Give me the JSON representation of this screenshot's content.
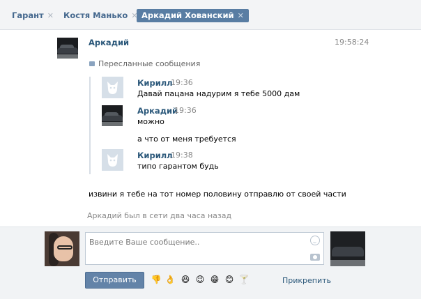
{
  "tabs": [
    {
      "label": "Гарант",
      "close": "✕",
      "active": false
    },
    {
      "label": "Костя Манько",
      "close": "✕",
      "active": false
    },
    {
      "label": "Аркадий Хованский",
      "close": "✕",
      "active": true
    }
  ],
  "message": {
    "author": "Аркадий",
    "time": "19:58:24",
    "forwarded_label": "Пересланные сообщения",
    "forwarded": [
      {
        "author": "Кирилл",
        "time": "19:36",
        "lines": [
          "Давай пацана надурим я тебе 5000 дам"
        ]
      },
      {
        "author": "Аркадий",
        "time": "19:36",
        "lines": [
          "можно",
          "а что от меня требуется"
        ]
      },
      {
        "author": "Кирилл",
        "time": "19:38",
        "lines": [
          "типо гарантом будь"
        ]
      }
    ],
    "text": "извини я тебе на тот номер половину отправлю от своей части"
  },
  "status": "Аркадий был в сети два часа назад",
  "composer": {
    "placeholder": "Введите Ваше сообщение..",
    "send_label": "Отправить",
    "attach_label": "Прикрепить",
    "emojis": [
      "👎",
      "👌",
      "😆",
      "😉",
      "😁",
      "😊",
      "🍸"
    ]
  },
  "colors": {
    "accent": "#597da3",
    "link": "#2b587a",
    "button": "#6383a8"
  }
}
